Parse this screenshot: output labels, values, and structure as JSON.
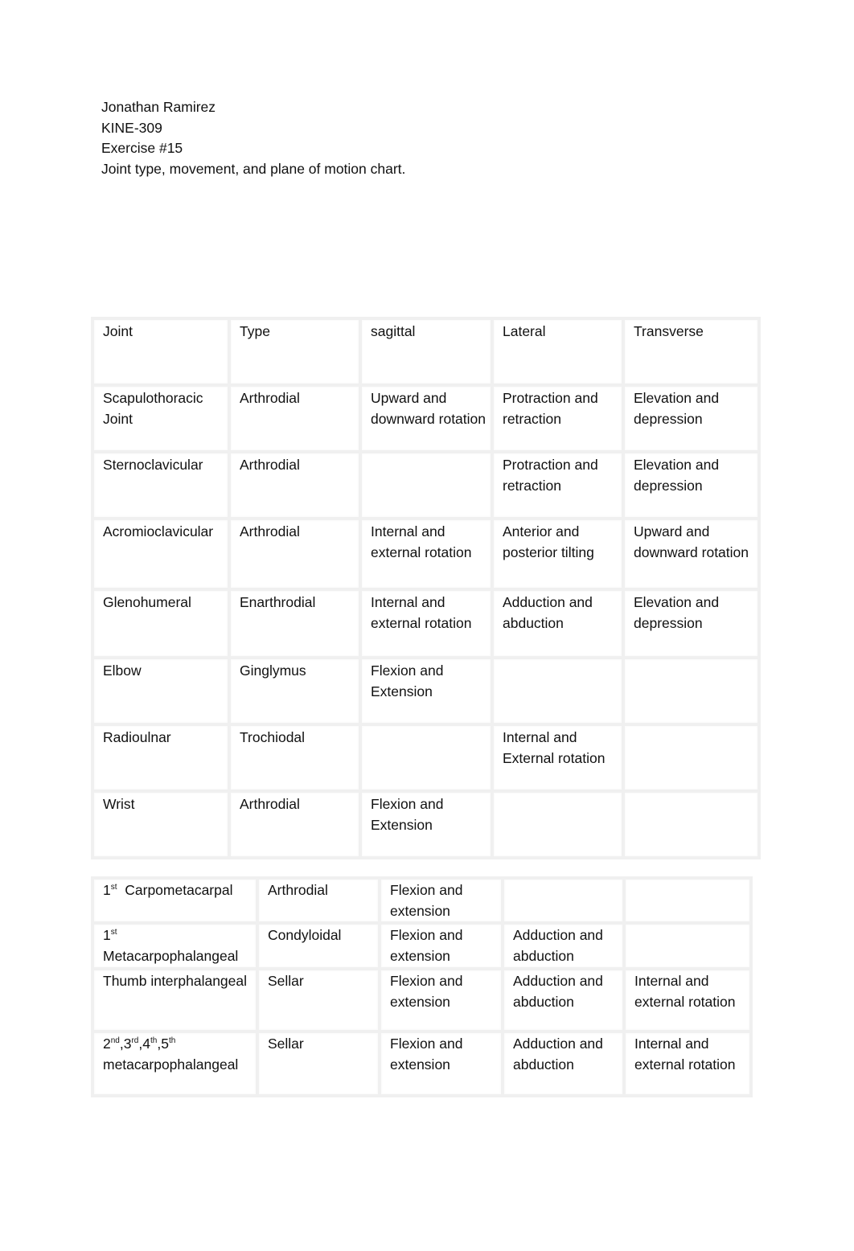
{
  "header": {
    "author": "Jonathan Ramirez",
    "course": "KINE-309",
    "exercise": "Exercise #15",
    "title": "Joint type, movement, and plane of motion chart."
  },
  "table1": {
    "columns": [
      "Joint",
      "Type",
      "sagittal",
      "Lateral",
      "Transverse"
    ],
    "rows": [
      {
        "joint": "Scapulothoracic Joint",
        "type": "Arthrodial",
        "sagittal": "Upward and downward rotation",
        "lateral": "Protraction and retraction",
        "transverse": "Elevation and depression"
      },
      {
        "joint": "Sternoclavicular",
        "type": "Arthrodial",
        "sagittal": "",
        "lateral": "Protraction and retraction",
        "transverse": "Elevation and depression"
      },
      {
        "joint": "Acromioclavicular",
        "type": "Arthrodial",
        "sagittal": "Internal and external rotation",
        "lateral": "Anterior and posterior tilting",
        "transverse": "Upward and downward rotation"
      },
      {
        "joint": "Glenohumeral",
        "type": "Enarthrodial",
        "sagittal": "Internal and external rotation",
        "lateral": "Adduction and abduction",
        "transverse": "Elevation and depression"
      },
      {
        "joint": "Elbow",
        "type": "Ginglymus",
        "sagittal": "Flexion and Extension",
        "lateral": "",
        "transverse": ""
      },
      {
        "joint": "Radioulnar",
        "type": "Trochiodal",
        "sagittal": "",
        "lateral": "Internal and External rotation",
        "transverse": ""
      },
      {
        "joint": "Wrist",
        "type": "Arthrodial",
        "sagittal": "Flexion and Extension",
        "lateral": "",
        "transverse": ""
      }
    ]
  },
  "table2": {
    "rows": [
      {
        "joint_num": "1",
        "joint_sup": "st",
        "joint_name": "Carpometacarpal",
        "type": "Arthrodial",
        "sagittal": "Flexion and extension",
        "lateral": "",
        "transverse": ""
      },
      {
        "joint_num": "1",
        "joint_sup": "st",
        "joint_name": "Metacarpophalangeal",
        "type": "Condyloidal",
        "sagittal": "Flexion and extension",
        "lateral": "Adduction and abduction",
        "transverse": ""
      },
      {
        "joint_name": "Thumb interphalangeal",
        "type": "Sellar",
        "sagittal": "Flexion and extension",
        "lateral": "Adduction and abduction",
        "transverse": "Internal and external rotation"
      },
      {
        "ordinals": [
          {
            "n": "2",
            "s": "nd"
          },
          {
            "n": "3",
            "s": "rd"
          },
          {
            "n": "4",
            "s": "th"
          },
          {
            "n": "5",
            "s": "th"
          }
        ],
        "joint_name": "metacarpophalangeal",
        "type": "Sellar",
        "sagittal": "Flexion and extension",
        "lateral": "Adduction and abduction",
        "transverse": "Internal and external rotation"
      }
    ]
  }
}
